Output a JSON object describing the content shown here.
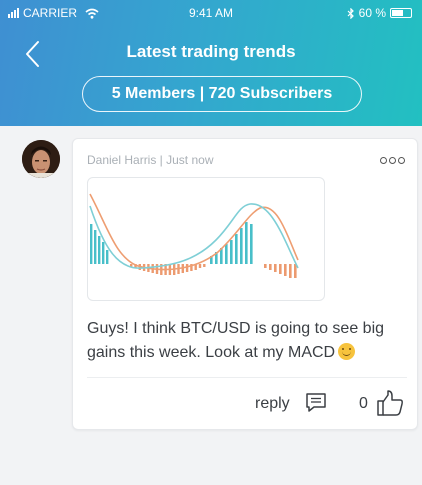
{
  "status_bar": {
    "carrier": "CARRIER",
    "time": "9:41 AM",
    "battery": "60 %",
    "battery_level": 0.6
  },
  "header": {
    "title": "Latest trading trends",
    "stats": "5 Members | 720 Subscribers",
    "back_icon": "chevron-left-icon"
  },
  "post": {
    "author_meta": "Daniel Harris | Just now",
    "text": "Guys! I think BTC/USD is going to see big gains this week. Look at my MACD",
    "emoji": "smiley-emoji",
    "reply_label": "reply",
    "likes": "0",
    "colors": {
      "positive": "#48bfc9",
      "negative": "#ec9a6f",
      "line_a": "#ee9e72",
      "line_b": "#7fcfd6"
    }
  }
}
